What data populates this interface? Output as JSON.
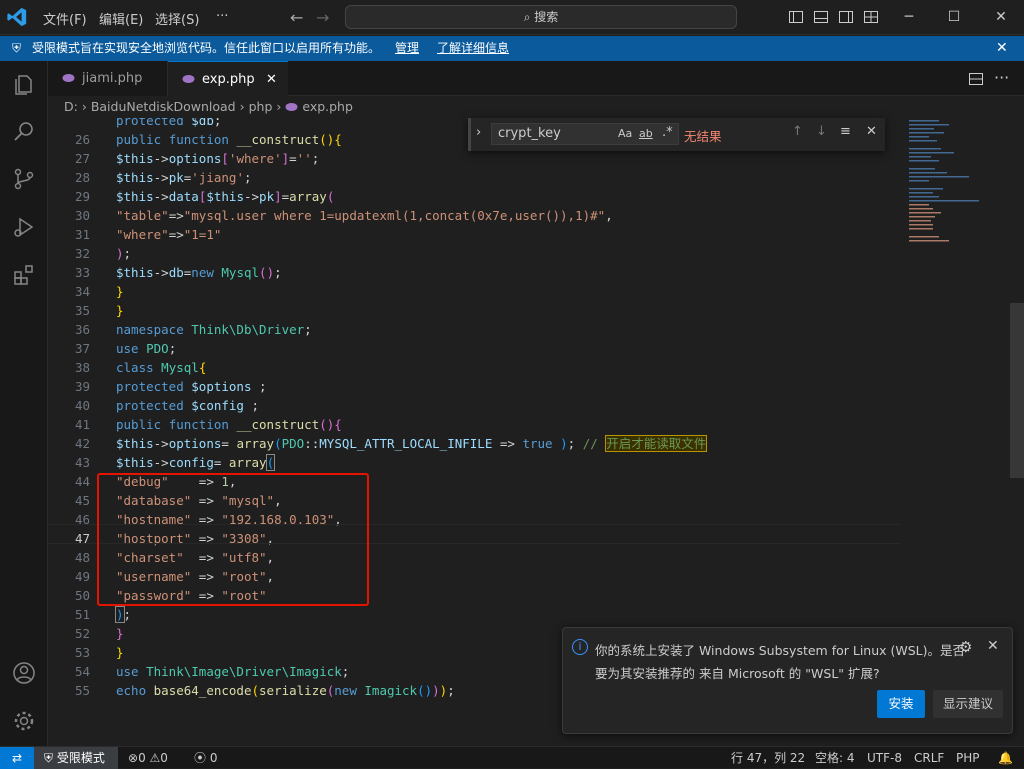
{
  "menu": {
    "file": "文件(F)",
    "edit": "编辑(E)",
    "select": "选择(S)",
    "more": "···"
  },
  "search": {
    "placeholder": "搜索"
  },
  "banner": {
    "text": "受限模式旨在实现安全地浏览代码。信任此窗口以启用所有功能。",
    "manage": "管理",
    "learn_more": "了解详细信息"
  },
  "tabs": [
    {
      "label": "jiami.php"
    },
    {
      "label": "exp.php"
    }
  ],
  "breadcrumb": {
    "drive": "D:",
    "folder": "BaiduNetdiskDownload",
    "sub": "php",
    "file": "exp.php"
  },
  "find": {
    "value": "crypt_key",
    "result": "无结果",
    "opt_case": "Aa",
    "opt_word": "ab",
    "opt_regex": ".*"
  },
  "code": {
    "l25": "protected $db;",
    "line_numbers": [
      "26",
      "27",
      "28",
      "29",
      "30",
      "31",
      "32",
      "33",
      "34",
      "35",
      "36",
      "37",
      "38",
      "39",
      "40",
      "41",
      "42",
      "43",
      "44",
      "45",
      "46",
      "47",
      "48",
      "49",
      "50",
      "51",
      "52",
      "53",
      "54",
      "55"
    ],
    "comment": "开启才能读取文件"
  },
  "notification": {
    "line1": "你的系统上安装了 Windows Subsystem for Linux (WSL)。是否",
    "line2": "要为其安装推荐的 来自 Microsoft 的 \"WSL\" 扩展?",
    "install": "安装",
    "show": "显示建议"
  },
  "status": {
    "restricted": "受限模式",
    "errors": "0",
    "warnings": "0",
    "ports": "0",
    "position": "行 47，列 22",
    "spaces": "空格: 4",
    "encoding": "UTF-8",
    "eol": "CRLF",
    "lang": "PHP"
  },
  "colors": {
    "accent": "#0078d4",
    "banner": "#0a5a9c",
    "highlight_box": "#e51400"
  }
}
